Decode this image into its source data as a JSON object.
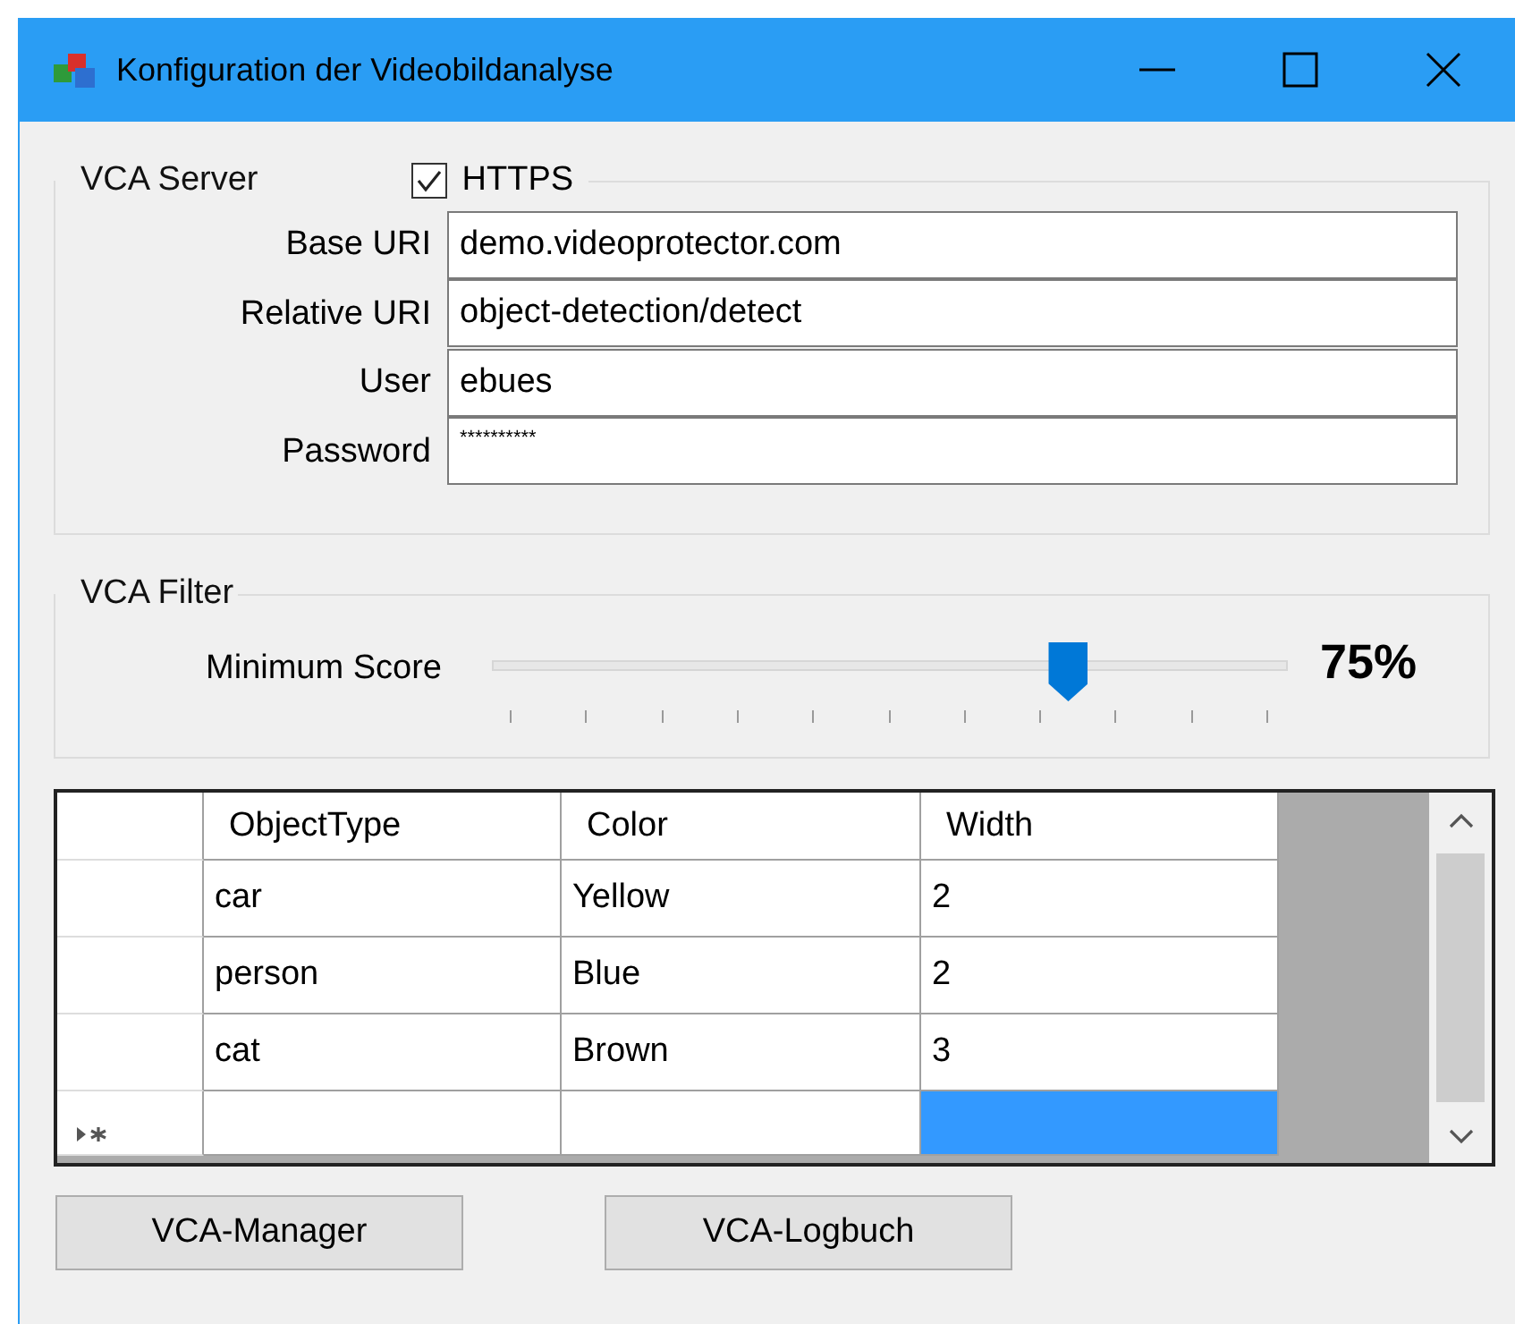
{
  "window": {
    "title": "Konfiguration der Videobildanalyse"
  },
  "server": {
    "title": "VCA Server",
    "https": {
      "label": "HTTPS",
      "checked": true
    },
    "fields": [
      {
        "label": "Base URI",
        "value": "demo.videoprotector.com"
      },
      {
        "label": "Relative URI",
        "value": "object-detection/detect"
      },
      {
        "label": "User",
        "value": "ebues"
      },
      {
        "label": "Password",
        "value": "**********"
      }
    ]
  },
  "filter": {
    "title": "VCA Filter",
    "label": "Minimum Score",
    "level": 0.75,
    "reading": "75%"
  },
  "table": {
    "columns": [
      "ObjectType",
      "Color",
      "Width"
    ],
    "rows": [
      {
        "cells": [
          "car",
          "Yellow",
          "2"
        ]
      },
      {
        "cells": [
          "person",
          "Blue",
          "2"
        ]
      },
      {
        "cells": [
          "cat",
          "Brown",
          "3"
        ]
      }
    ],
    "new_row": {
      "cells": [
        {
          "selected": false
        },
        {
          "selected": false
        },
        {
          "selected": true
        }
      ]
    }
  },
  "buttons": [
    "VCA-Manager",
    "VCA-Logbuch"
  ]
}
